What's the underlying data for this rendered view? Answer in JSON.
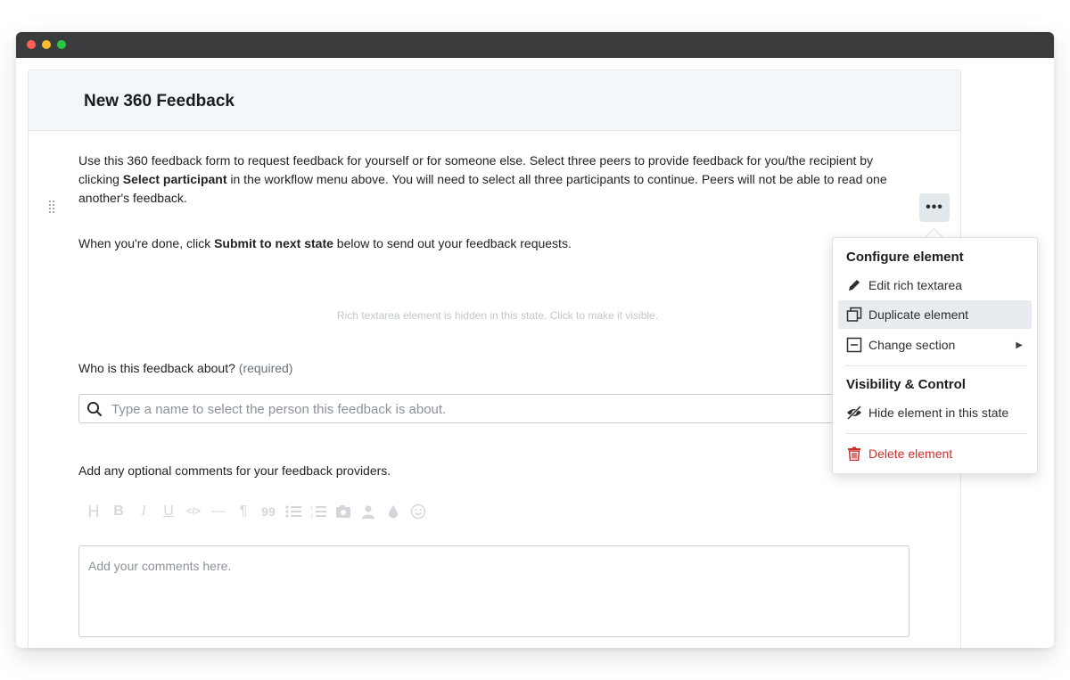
{
  "form": {
    "title": "New 360 Feedback",
    "intro": {
      "part1": "Use this 360 feedback form to request feedback for yourself or for someone else. Select three peers to provide feedback for you/the recipient by clicking ",
      "bold1": "Select participant",
      "part2": " in the workflow menu above. You will need to select all three participants to continue. Peers will not be able to read one another's feedback."
    },
    "intro2": {
      "part1": "When you're done, click ",
      "bold1": "Submit to next state",
      "part2": " below to send out your feedback requests."
    },
    "hidden_note": "Rich textarea element is hidden in this state. Click to make it visible.",
    "question": {
      "label": "Who is this feedback about?",
      "required": "(required)",
      "placeholder": "Type a name to select the person this feedback is about."
    },
    "comments": {
      "label": "Add any optional comments for your feedback providers.",
      "placeholder": "Add your comments here."
    },
    "more_button": "•••"
  },
  "toolbar": {
    "icons": [
      "heading-icon",
      "bold-icon",
      "italic-icon",
      "underline-icon",
      "code-icon",
      "horizontal-rule-icon",
      "paragraph-icon",
      "quote-icon",
      "bullet-list-icon",
      "numbered-list-icon",
      "image-icon",
      "person-icon",
      "color-drop-icon",
      "emoji-icon"
    ],
    "glyphs": {
      "heading": "H",
      "bold": "B",
      "italic": "I",
      "underline": "U",
      "code": "</>",
      "hr": "—",
      "paragraph": "¶",
      "quote": "99"
    }
  },
  "menu": {
    "section1": "Configure element",
    "items": [
      {
        "label": "Edit rich textarea",
        "icon": "pencil-icon"
      },
      {
        "label": "Duplicate element",
        "icon": "duplicate-icon"
      },
      {
        "label": "Change section",
        "icon": "section-icon"
      }
    ],
    "section2": "Visibility & Control",
    "hide_label": "Hide element in this state",
    "delete_label": "Delete element"
  },
  "colors": {
    "danger": "#c9302c",
    "header_bg": "#f3f7fa",
    "menu_active": "#e8ecf0"
  }
}
